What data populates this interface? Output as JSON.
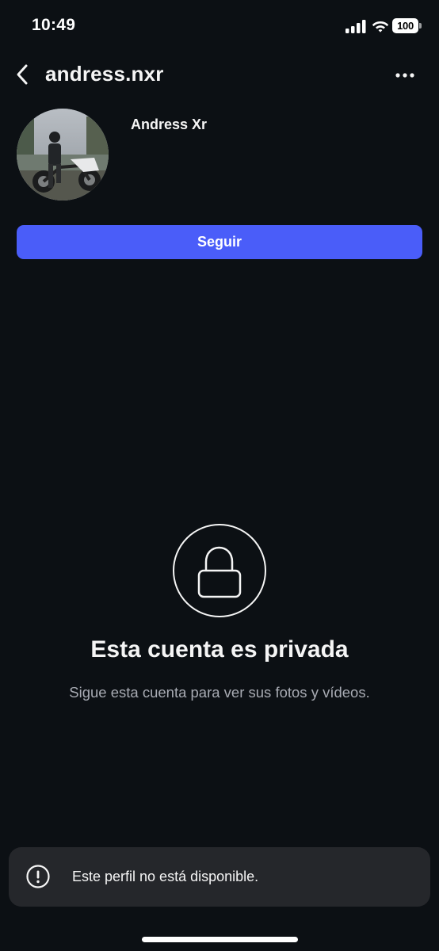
{
  "status_bar": {
    "time": "10:49",
    "battery": "100",
    "icons": [
      "signal-icon",
      "wifi-icon",
      "battery-icon"
    ]
  },
  "header": {
    "username": "andress.nxr",
    "icons": [
      "back-arrow-icon",
      "more-options-icon"
    ]
  },
  "profile": {
    "display_name": "Andress Xr",
    "follow_label": "Seguir"
  },
  "private_notice": {
    "title": "Esta cuenta es privada",
    "subtitle": "Sigue esta cuenta para ver sus fotos y vídeos.",
    "icon": "lock-icon"
  },
  "toast": {
    "message": "Este perfil no está disponible.",
    "icon": "exclamation-circle-icon"
  },
  "colors": {
    "background": "#0c1014",
    "accent": "#4a5df9",
    "toast_bg": "#25272b",
    "secondary_text": "#a8abb3"
  }
}
